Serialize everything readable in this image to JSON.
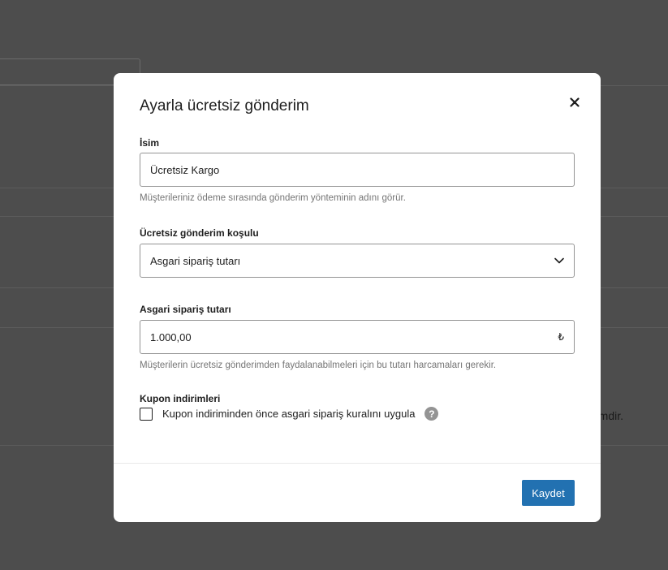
{
  "background": {
    "partial_text": "mdir."
  },
  "modal": {
    "title": "Ayarla ücretsiz gönderim",
    "close_icon": "close-icon",
    "name_field": {
      "label": "İsim",
      "value": "Ücretsiz Kargo",
      "help": "Müşterileriniz ödeme sırasında gönderim yönteminin adını görür."
    },
    "condition_field": {
      "label": "Ücretsiz gönderim koşulu",
      "selected": "Asgari sipariş tutarı",
      "icon": "chevron-down-icon"
    },
    "amount_field": {
      "label": "Asgari sipariş tutarı",
      "value": "1.000,00",
      "currency": "₺",
      "help": "Müşterilerin ücretsiz gönderimden faydalanabilmeleri için bu tutarı harcamaları gerekir."
    },
    "coupon_field": {
      "label": "Kupon indirimleri",
      "checkbox_label": "Kupon indiriminden önce asgari sipariş kuralını uygula",
      "checked": false,
      "help_icon": "help-icon",
      "help_glyph": "?"
    },
    "save_label": "Kaydet"
  },
  "colors": {
    "primary": "#2271b1",
    "overlay": "#4d4d4d",
    "border": "#949494",
    "help_text": "#757575"
  }
}
